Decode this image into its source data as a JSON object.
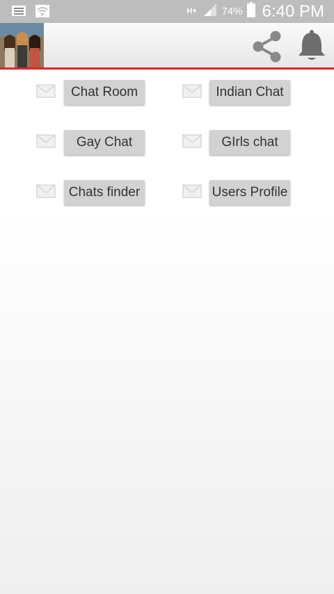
{
  "status_bar": {
    "network": "H+",
    "battery_percent": "74%",
    "time": "6:40 PM",
    "icons": [
      "notification-icon",
      "wifi-icon",
      "signal-icon",
      "battery-icon"
    ]
  },
  "app_bar": {
    "accent_color": "#d9282f",
    "icons": [
      "share-icon",
      "bell-icon"
    ]
  },
  "menu": {
    "items": [
      {
        "label": "Chat Room"
      },
      {
        "label": "Indian Chat"
      },
      {
        "label": "Gay Chat"
      },
      {
        "label": "GIrls chat"
      },
      {
        "label": "Chats finder"
      },
      {
        "label": "Users Profile"
      }
    ]
  }
}
